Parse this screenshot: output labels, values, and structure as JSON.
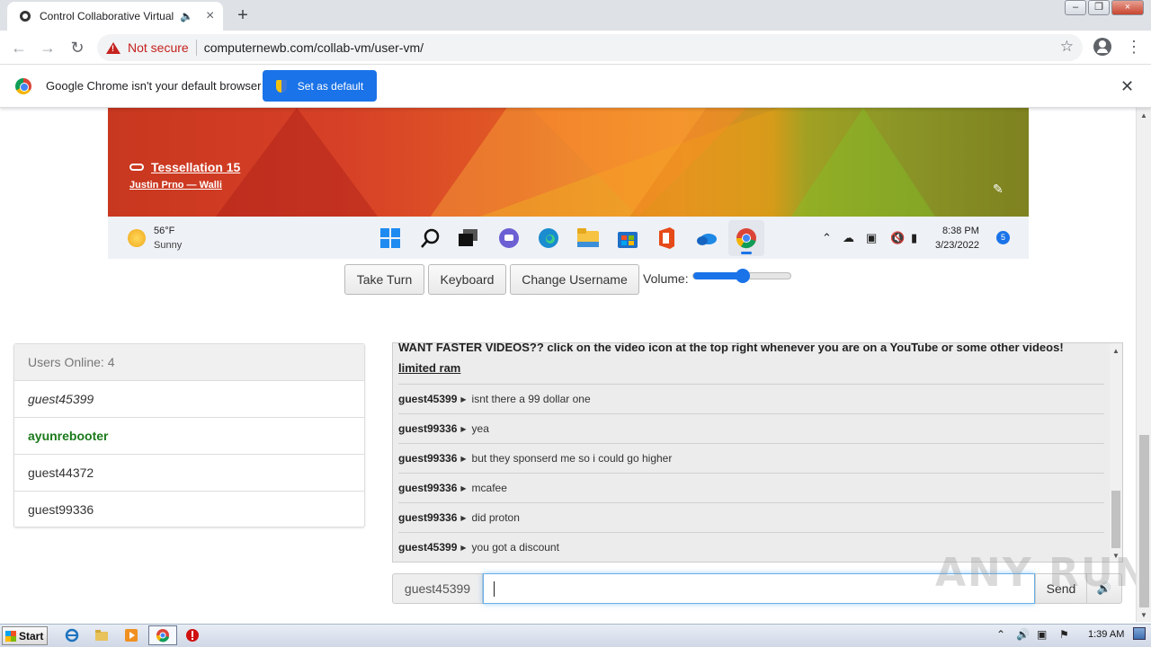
{
  "browser": {
    "tab_title": "Control Collaborative Virtual Ma",
    "not_secure": "Not secure",
    "url": "computernewb.com/collab-vm/user-vm/",
    "infobar_text": "Google Chrome isn't your default browser",
    "set_default_label": "Set as default"
  },
  "vm": {
    "wallpaper_title": "Tessellation 15",
    "wallpaper_author": "Justin Prno — Walli",
    "weather_temp": "56°F",
    "weather_cond": "Sunny",
    "clock_time": "8:38 PM",
    "clock_date": "3/23/2022",
    "notification_count": "5"
  },
  "controls": {
    "take_turn": "Take Turn",
    "keyboard": "Keyboard",
    "change_username": "Change Username",
    "volume_label": "Volume:",
    "volume_level": 0.5
  },
  "users": {
    "header": "Users Online: 4",
    "list": [
      {
        "name": "guest45399",
        "style": "italic"
      },
      {
        "name": "ayunrebooter",
        "style": "admin"
      },
      {
        "name": "guest44372",
        "style": "normal"
      },
      {
        "name": "guest99336",
        "style": "normal"
      }
    ]
  },
  "chat": {
    "banner": "WANT FASTER VIDEOS?? click on the video icon at the top right whenever you are on a YouTube or some other videos!",
    "banner2": "limited ram",
    "messages": [
      {
        "user": "guest45399",
        "text": "isnt there a 99 dollar one"
      },
      {
        "user": "guest99336",
        "text": "yea"
      },
      {
        "user": "guest99336",
        "text": "but they sponserd me so i could go higher"
      },
      {
        "user": "guest99336",
        "text": "mcafee"
      },
      {
        "user": "guest99336",
        "text": "did proton"
      },
      {
        "user": "guest45399",
        "text": "you got a discount"
      }
    ],
    "username": "guest45399",
    "input_value": "",
    "send_label": "Send"
  },
  "watermark": "ANY RUN",
  "host_taskbar": {
    "start_label": "Start",
    "clock": "1:39 AM"
  },
  "colors": {
    "admin_user": "#1a7a1a",
    "accent": "#1a73e8",
    "not_secure": "#c5221f"
  }
}
